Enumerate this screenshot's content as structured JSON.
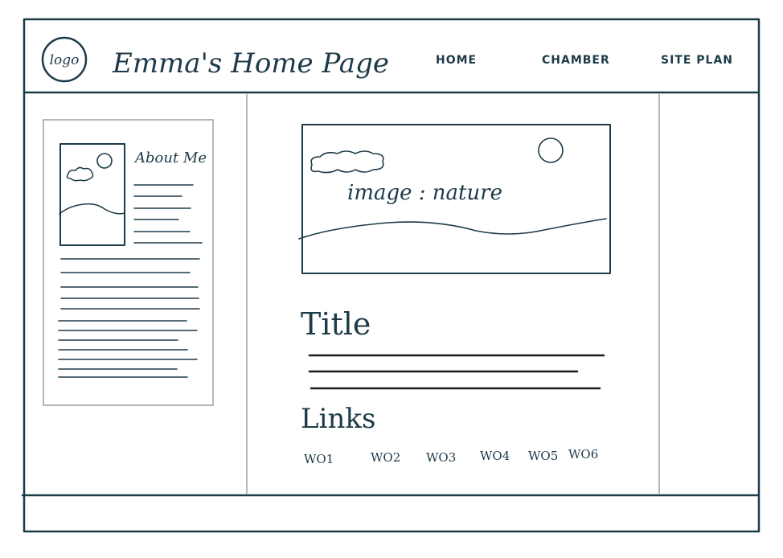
{
  "header": {
    "logo_text": "logo",
    "site_title": "Emma's Home Page",
    "nav": [
      {
        "label": "HOME"
      },
      {
        "label": "CHAMBER"
      },
      {
        "label": "SITE PLAN"
      }
    ]
  },
  "sidebar": {
    "heading": "About Me"
  },
  "main": {
    "image_caption": "image : nature",
    "title": "Title",
    "links_heading": "Links",
    "links": [
      {
        "label": "WO1"
      },
      {
        "label": "WO2"
      },
      {
        "label": "WO3"
      },
      {
        "label": "WO4"
      },
      {
        "label": "WO5"
      },
      {
        "label": "WO6"
      }
    ]
  },
  "colors": {
    "ink": "#1d3a48",
    "divider": "#b8b8b8",
    "text_lines": "#1a1a1a"
  }
}
